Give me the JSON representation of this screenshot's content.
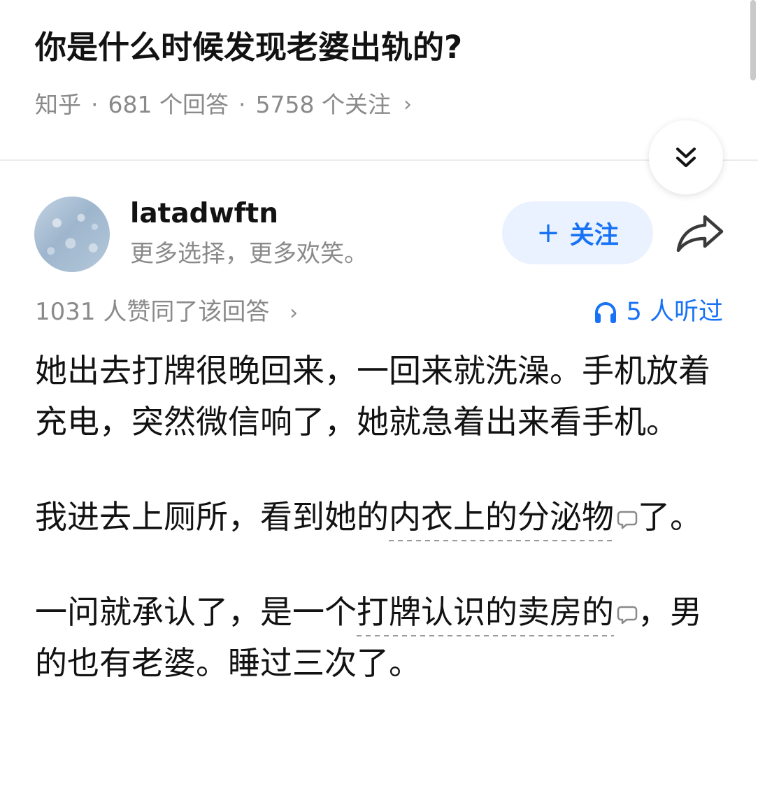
{
  "question": {
    "title": "你是什么时候发现老婆出轨的?",
    "source": "知乎",
    "separator": "·",
    "answers_count": "681 个回答",
    "followers_count": "5758 个关注",
    "meta_chevron": "›"
  },
  "author": {
    "name": "latadwftn",
    "bio": "更多选择，更多欢笑。",
    "follow_plus": "+",
    "follow_label": "关注"
  },
  "stats": {
    "votes": "1031 人赞同了该回答",
    "votes_chevron": "›",
    "listeners": "5 人听过"
  },
  "content": {
    "p1": "她出去打牌很晚回来，一回来就洗澡。手机放着充电，突然微信响了，她就急着出来看手机。",
    "p2_a": "我进去上厕所，看到她的",
    "p2_link": "内衣上的分泌物",
    "p2_b": "了。",
    "p3_a": "一问就承认了，是一个",
    "p3_link": "打牌认识的卖房的",
    "p3_b": "，男的也有老婆。睡过三次了。"
  },
  "colors": {
    "accent": "#1772f6",
    "follow_bg": "#eaf2ff",
    "muted_text": "#8a8a8a"
  },
  "icons": {
    "collapse": "double-chevron-down-icon",
    "share": "share-arrow-icon",
    "headphones": "headphones-icon",
    "comment": "comment-bubble-icon"
  }
}
